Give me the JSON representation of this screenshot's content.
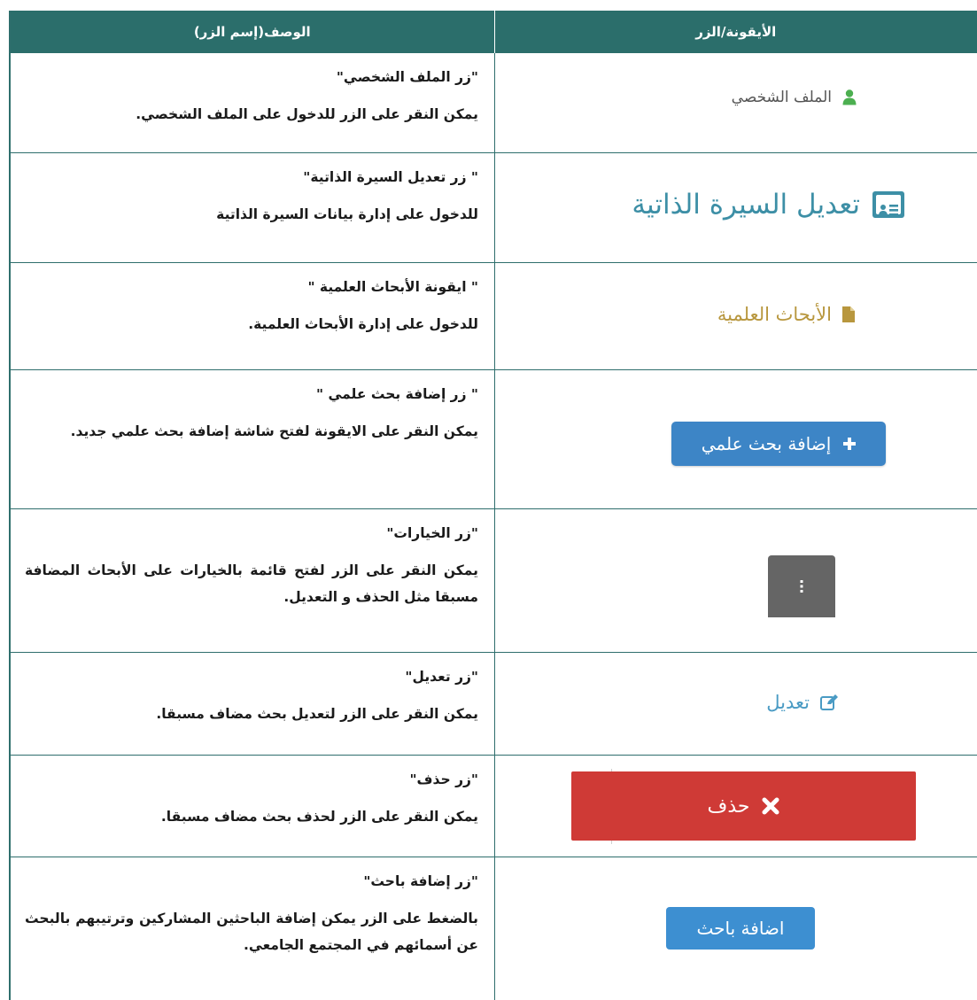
{
  "header": {
    "icon_col": "الأيقونة/الزر",
    "desc_col": "الوصف(إسم الزر)"
  },
  "rows": [
    {
      "button_label": "الملف الشخصي",
      "icon": "user-icon",
      "title": "\"زر الملف الشخصي\"",
      "body": "يمكن النقر على الزر للدخول على الملف الشخصي."
    },
    {
      "button_label": "تعديل السيرة الذاتية",
      "icon": "id-card-icon",
      "title": "\" زر تعديل السيرة الذاتية\"",
      "body": "للدخول على إدارة بيانات السيرة الذاتية"
    },
    {
      "button_label": "الأبحاث العلمية",
      "icon": "file-icon",
      "title": "\" ايقونة الأبحاث العلمية \"",
      "body": "للدخول على إدارة الأبحاث العلمية."
    },
    {
      "button_label": "إضافة بحث علمي",
      "icon": "plus-icon",
      "title": "\" زر إضافة بحث علمي \"",
      "body": "يمكن النقر على الايقونة لفتح شاشة إضافة بحث علمي جديد."
    },
    {
      "button_label": "",
      "icon": "vertical-dots-icon",
      "title": "\"زر الخيارات\"",
      "body": "يمكن النقر على الزر لفتح قائمة بالخيارات على الأبحاث المضافة مسبقا مثل الحذف و التعديل."
    },
    {
      "button_label": "تعديل",
      "icon": "edit-icon",
      "title": "\"زر تعديل\"",
      "body": "يمكن النقر على الزر لتعديل بحث مضاف مسبقا."
    },
    {
      "button_label": "حذف",
      "icon": "times-icon",
      "title": "\"زر حذف\"",
      "body": "يمكن النقر على الزر لحذف بحث مضاف مسبقا."
    },
    {
      "button_label": "اضافة باحث",
      "icon": "",
      "title": "\"زر إضافة باحث\"",
      "body": "بالضغط على الزر يمكن إضافة الباحثين المشاركين وترتيبهم بالبحث عن أسمائهم في المجتمع الجامعي."
    }
  ],
  "colors": {
    "header_bg": "#2b6e6b",
    "profile_icon": "#4caf50",
    "cv_accent": "#3d8fa6",
    "research_accent": "#b8973e",
    "add_button": "#3d85c6",
    "options_button": "#656565",
    "edit_accent": "#4a9bc4",
    "delete_button": "#cf3a36",
    "add_researcher_button": "#3d8fd1"
  }
}
